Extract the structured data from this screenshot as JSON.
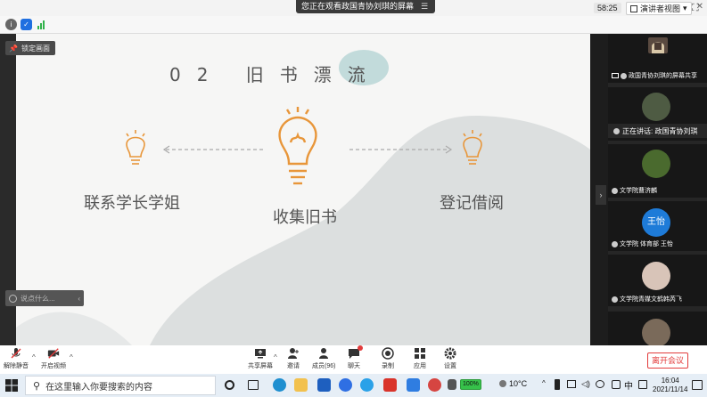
{
  "notice": {
    "text": "您正在观看政国青协刘琪的屏幕",
    "menu_icon": "hamburger-icon"
  },
  "toolbar": {
    "time": "58:25",
    "view_label": "演讲者视图",
    "view_caret": "▾"
  },
  "lock_screen": {
    "label": "锁定画面"
  },
  "slide": {
    "title": "02 旧书漂流",
    "left_label": "联系学长学姐",
    "center_label": "收集旧书",
    "right_label": "登记借阅",
    "colors": {
      "accent": "#e8963a",
      "gray_blob": "#dcdfdf",
      "teal_blob": "#b8d6d6"
    }
  },
  "chat": {
    "placeholder": "说点什么...",
    "arrow": "‹"
  },
  "panel": {
    "tiles": [
      {
        "label": "政国青协刘琪的屏幕共享"
      },
      {
        "label": "正在讲话: 政国青协刘琪"
      },
      {
        "label": "文学院曹济麟"
      },
      {
        "label": "文学院 体育部 王怡",
        "avatar_text": "王怡"
      },
      {
        "label": "文学院青媒文鹤韩芮飞"
      }
    ]
  },
  "controls": {
    "mute": "解除静音",
    "video": "开启视频",
    "share": "共享屏幕",
    "invite": "邀请",
    "members": "成员(96)",
    "chat": "聊天",
    "record": "录制",
    "apps": "应用",
    "settings": "设置",
    "leave": "离开会议"
  },
  "taskbar": {
    "search_placeholder": "在这里输入你要搜索的内容",
    "battery": "100%",
    "weather": "10°C",
    "time": "16:04",
    "date": "2021/11/14",
    "ime": "中"
  }
}
